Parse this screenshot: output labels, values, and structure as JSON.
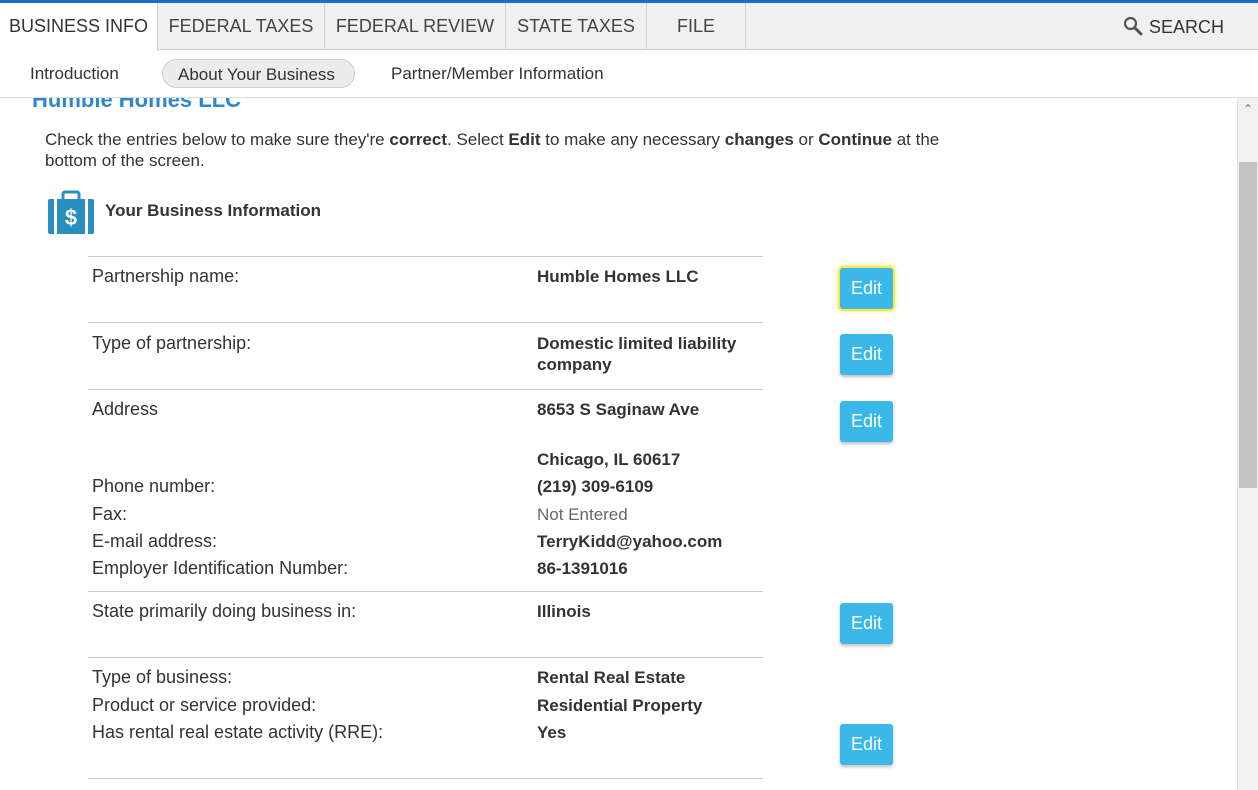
{
  "tabs": [
    {
      "label": "BUSINESS INFO"
    },
    {
      "label": "FEDERAL TAXES"
    },
    {
      "label": "FEDERAL REVIEW"
    },
    {
      "label": "STATE TAXES"
    },
    {
      "label": "FILE"
    }
  ],
  "search": {
    "label": "SEARCH",
    "icon": "search-icon"
  },
  "subnav": [
    {
      "label": "Introduction"
    },
    {
      "label": "About Your Business"
    },
    {
      "label": "Partner/Member Information"
    }
  ],
  "business_name": "Humble Homes LLC",
  "instructions": {
    "t1": "Check the entries below to make sure they're ",
    "b1": "correct",
    "t2": ". Select ",
    "b2": "Edit",
    "t3": " to make any necessary ",
    "b3": "changes",
    "t4": " or ",
    "b4": "Continue",
    "t5": " at the bottom of the screen."
  },
  "section": {
    "title": "Your Business Information",
    "icon": "briefcase-dollar-icon"
  },
  "edit_label": "Edit",
  "rows": {
    "partnership_name": {
      "label": "Partnership name:",
      "value": "Humble Homes LLC"
    },
    "partnership_type": {
      "label": "Type of partnership:",
      "value_line1": "Domestic limited liability",
      "value_line2": "company"
    },
    "address": {
      "label": "Address",
      "street": "8653 S Saginaw Ave",
      "city": "Chicago, IL  60617"
    },
    "phone": {
      "label": "Phone number:",
      "value": "(219) 309-6109"
    },
    "fax": {
      "label": "Fax:",
      "value": "Not Entered"
    },
    "email": {
      "label": "E-mail address:",
      "value": "TerryKidd@yahoo.com"
    },
    "ein": {
      "label": "Employer Identification Number:",
      "value": "86-1391016"
    },
    "state": {
      "label": "State primarily doing business in:",
      "value": "Illinois"
    },
    "business_type": {
      "label": "Type of business:",
      "value": "Rental Real Estate"
    },
    "product": {
      "label": "Product or service provided:",
      "value": "Residential Property"
    },
    "rre": {
      "label": "Has rental real estate activity (RRE):",
      "value": "Yes"
    }
  },
  "colors": {
    "accent": "#3ab8ea",
    "title_blue": "#2f86cf",
    "top_line": "#1a6fc4",
    "focus_ring": "#f5e94a"
  }
}
